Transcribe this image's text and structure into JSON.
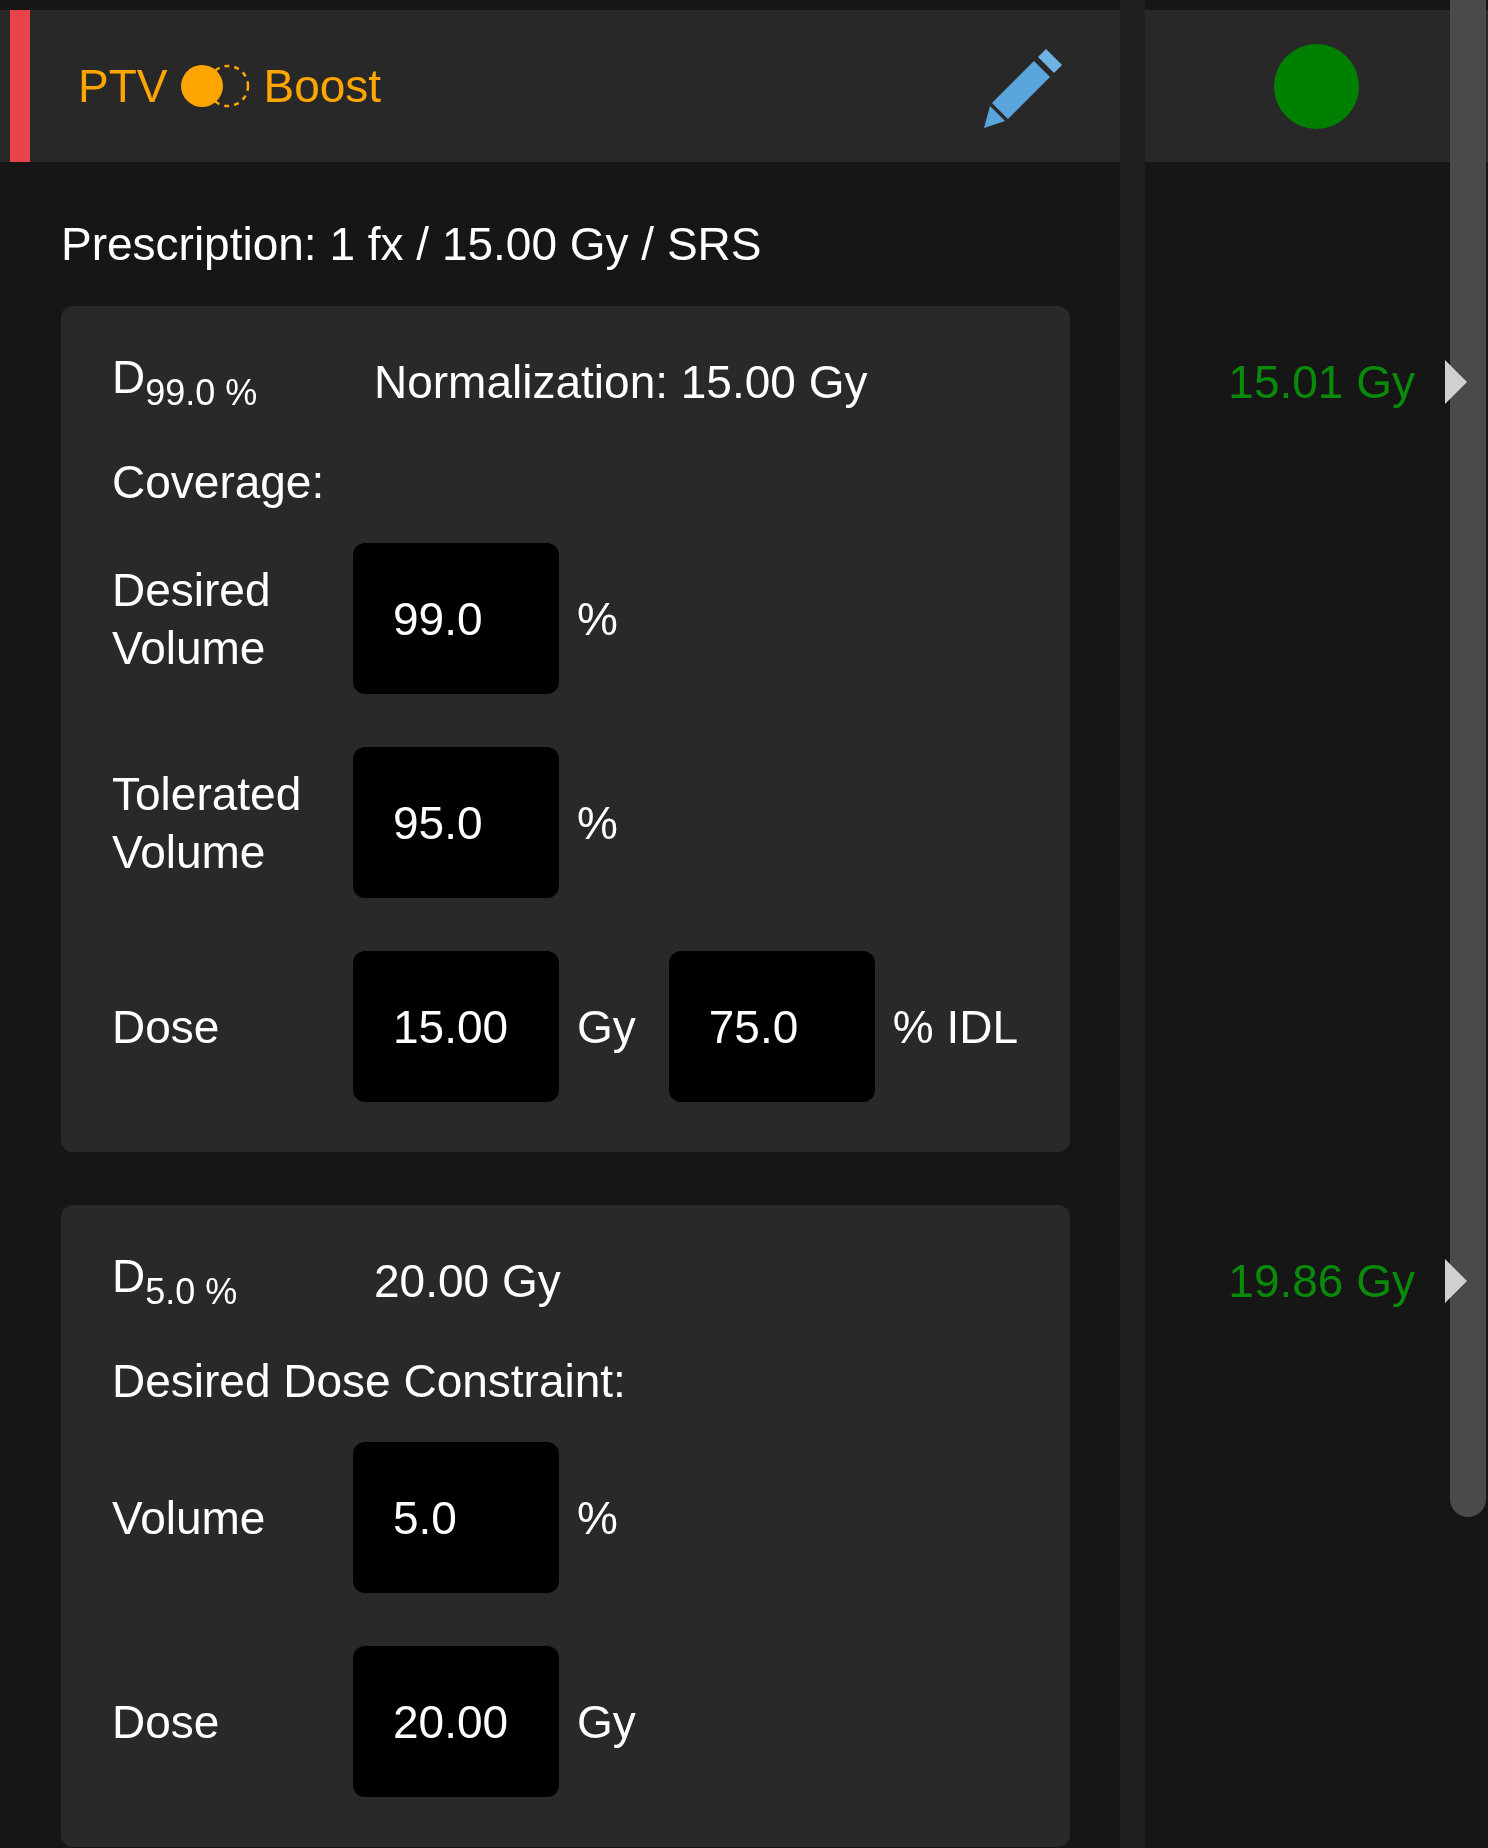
{
  "header": {
    "title_prefix": "PTV",
    "title_suffix": "Boost",
    "color": "#008000"
  },
  "prescription": "Prescription: 1 fx / 15.00 Gy / SRS",
  "objectives": [
    {
      "metric": "D$_{99.0 %}$",
      "value_label": "Normalization: 15.00 Gy",
      "section": "Coverage:",
      "result": "15.01 Gy",
      "rows": [
        {
          "label": "Desired Volume",
          "inputs": [
            {
              "value": "99.0",
              "unit": "%"
            }
          ]
        },
        {
          "label": "Tolerated Volume",
          "inputs": [
            {
              "value": "95.0",
              "unit": "%"
            }
          ]
        },
        {
          "label": "Dose",
          "inputs": [
            {
              "value": "15.00",
              "unit": "Gy"
            },
            {
              "value": "75.0",
              "unit": "% IDL"
            }
          ]
        }
      ]
    },
    {
      "metric": "D$_{5.0 %}$",
      "value_label": "20.00 Gy",
      "section": "Desired Dose Constraint:",
      "result": "19.86 Gy",
      "rows": [
        {
          "label": "Volume",
          "inputs": [
            {
              "value": "5.0",
              "unit": "%"
            }
          ]
        },
        {
          "label": "Dose",
          "inputs": [
            {
              "value": "20.00",
              "unit": "Gy"
            }
          ]
        }
      ]
    }
  ]
}
